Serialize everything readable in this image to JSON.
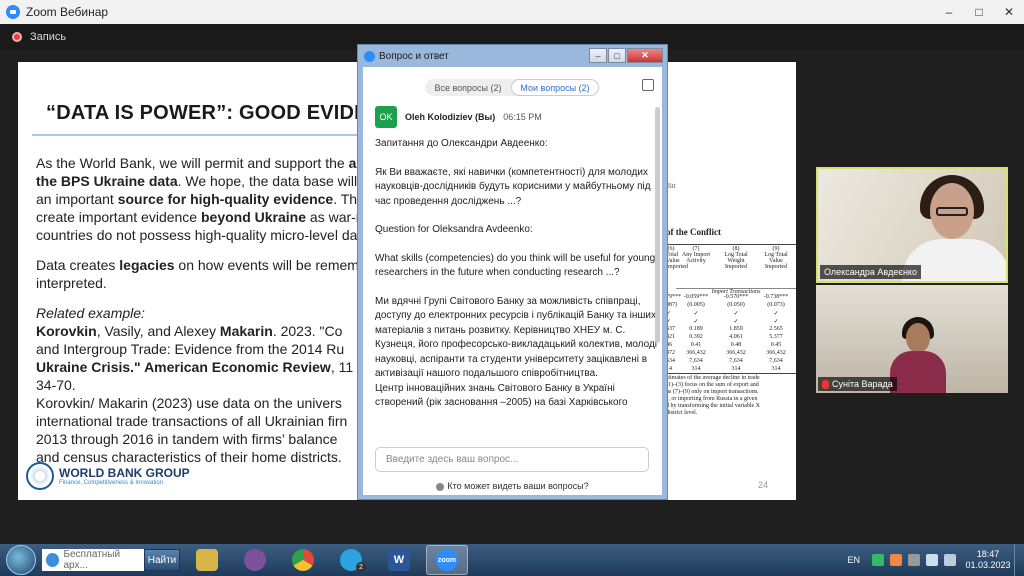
{
  "window": {
    "title": "Zoom Вебинар",
    "controls": [
      "–",
      "□",
      "✕"
    ]
  },
  "recording": {
    "label": "Запись"
  },
  "slide": {
    "title": "“DATA IS POWER”: GOOD EVIDENC",
    "paragraphs": {
      "p1_l1_a": "As the World Bank, we will permit and support the ",
      "p1_l1_b": "ar",
      "p1_l2_a": "the BPS Ukraine data",
      "p1_l2_b": ". We hope, the data base will",
      "p1_l3_a": "an important ",
      "p1_l3_b": "source for high-quality evidence",
      "p1_l3_c": ". Thi",
      "p1_l4_a": "create important evidence ",
      "p1_l4_b": "beyond Ukraine",
      "p1_l4_c": " as war-r",
      "p1_l5": "countries do not possess high-quality micro-level dat",
      "p2_l1_a": "Data creates ",
      "p2_l1_b": "legacies",
      "p2_l1_c": " on how events will be rememl",
      "p2_l2": "interpreted.",
      "p3_label": "Related example:",
      "p3_l1_a": "Korovkin",
      "p3_l1_b": ", Vasily, and Alexey ",
      "p3_l1_c": "Makarin",
      "p3_l1_d": ". 2023. \"Co",
      "p3_l2": "and Intergroup Trade: Evidence from the 2014 Ru",
      "p3_l3_a": "Ukraine Crisis.\" ",
      "p3_l3_b": "American Economic Review",
      "p3_l3_c": ", 11",
      "p3_l4": "34-70.",
      "p4_l1": "Korovkin/ Makarin (2023) use data on the univers",
      "p4_l2": "international trade transactions of all Ukrainian firn",
      "p4_l3": "2013 through 2016 in tandem with firms’ balance",
      "p4_l4": "and census characteristics of their home districts."
    },
    "logo": {
      "name": "WORLD BANK GROUP",
      "sub": "Finance, Competitiveness & Innovation"
    },
    "page_number": "24",
    "table": {
      "y_label": "ilitt",
      "title": "of the Conflict",
      "columns": [
        "(7)\nAny Import\nActivity",
        "(8)\nLog Total\nWeight\nImported",
        "(9)\nLog Total\nValue\nImported"
      ],
      "col0": [
        "(6)\nTotal\nValue\nImported"
      ],
      "subheader": "Import Transactions",
      "rows": [
        [
          "79***",
          "-0.059***",
          "-0.570***",
          "-0.738***"
        ],
        [
          "087)",
          "(0.005)",
          "(0.050)",
          "(0.073)"
        ],
        [
          "✓",
          "✓",
          "✓",
          "✓"
        ],
        [
          "✓",
          "✓",
          "✓",
          "✓"
        ],
        [
          "637",
          "0.189",
          "1.859",
          "2.565"
        ],
        [
          "421",
          "0.392",
          "4.061",
          "5.377"
        ],
        [
          "46",
          "0.41",
          "0.48",
          "0.45"
        ],
        [
          "472",
          "366,432",
          "366,432",
          "366,432"
        ],
        [
          "634",
          "7,634",
          "7,634",
          "7,634"
        ],
        [
          "14",
          "314",
          "314",
          "314"
        ]
      ],
      "notes": [
        "stimates of the average decline in trade",
        "(1)–(3) focus on the sum of export and",
        "ns (7)–(9) only on import transactions.",
        "s, or importing from Russia in a given",
        "d by transforming the initial variable X",
        "district level."
      ]
    }
  },
  "qa": {
    "title": "Вопрос и ответ",
    "tabs": {
      "all": "Все вопросы (2)",
      "mine": "Мои вопросы (2)"
    },
    "message": {
      "avatar": "OK",
      "author": "Oleh Kolodiziev (Вы)",
      "time": "06:15 PM",
      "p1": "Запитання до Олександри Авдеенко:",
      "p2": "Як Ви вважаєте, які навички (компетентності) для молодих науковців-дослідників будуть корисними у майбутньому під час проведення досліджень ...?",
      "p3": "Question for Oleksandra Avdeenko:",
      "p4": "What skills (competencies) do you think will be useful for young researchers in the future when conducting research ...?",
      "p5": "Ми вдячні Групі Світового Банку за можливість співпраці, доступу до електронних ресурсів і публікацій Банку та інших матеріалів з питань розвитку. Керівництво ХНЕУ м. С. Кузнеця, його професорсько-викладацький колектив, молоді науковці, аспіранти та студенти університету зацікавлені в активізації нашого подальшого співробітництва.",
      "p6": "Центр інноваційних знань Світового Банку в Україні створений (рік засновання –2005) на базі Харківського"
    },
    "input_placeholder": "Введите здесь ваш вопрос...",
    "footer": "Кто может видеть ваши вопросы?"
  },
  "videos": [
    {
      "name": "Олександра Авдеєнко"
    },
    {
      "name": "Суніта Варада"
    }
  ],
  "taskbar": {
    "search_text": "Бесплатный арх...",
    "search_button": "Найти",
    "apps": [
      {
        "icon": "file-explorer-icon",
        "label": "",
        "color": "#d9b44a"
      },
      {
        "icon": "viber-icon",
        "label": "",
        "color": "#7b519d"
      },
      {
        "icon": "chrome-icon",
        "label": "",
        "color": "#e04a3a"
      },
      {
        "icon": "telegram-icon",
        "label": "",
        "color": "#2aa3df",
        "badge": "2"
      },
      {
        "icon": "word-icon",
        "label": "W",
        "color": "#2b579a"
      },
      {
        "icon": "zoom-icon",
        "label": "zoom",
        "color": "#2d8cff"
      }
    ],
    "lang": "EN",
    "time": "18:47",
    "date": "01.03.2023"
  }
}
